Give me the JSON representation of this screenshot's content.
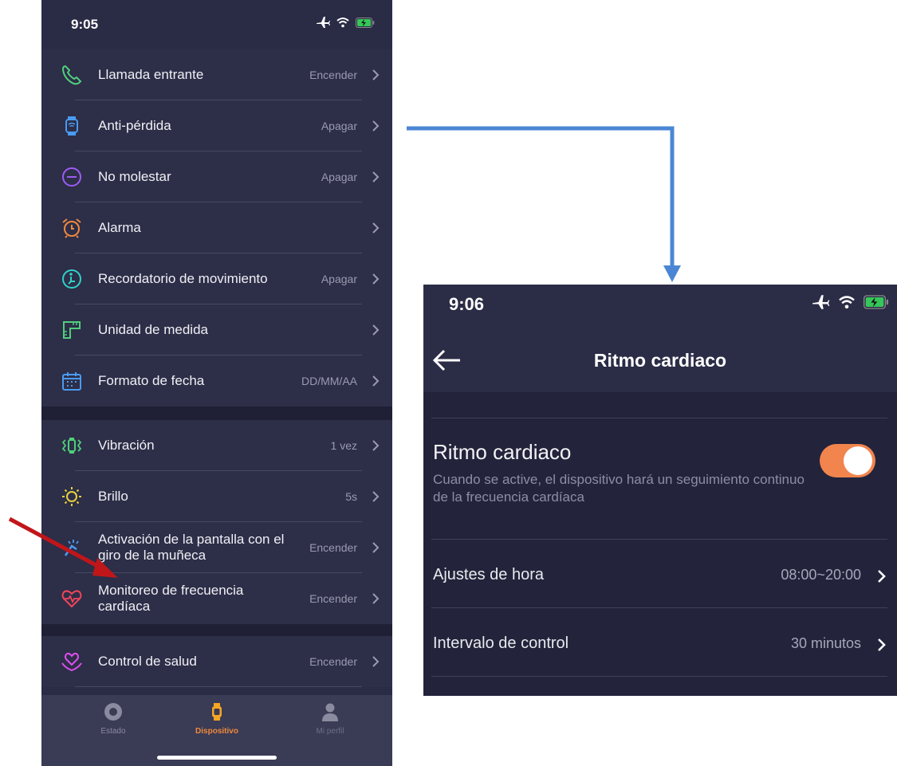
{
  "left_screen": {
    "status_time": "9:05",
    "settings_group_1": [
      {
        "label": "Llamada entrante",
        "value": "Encender",
        "icon": "phone-icon"
      },
      {
        "label": "Anti-pérdida",
        "value": "Apagar",
        "icon": "watch-signal-icon"
      },
      {
        "label": "No molestar",
        "value": "Apagar",
        "icon": "do-not-disturb-icon"
      },
      {
        "label": "Alarma",
        "value": "",
        "icon": "alarm-clock-icon"
      },
      {
        "label": "Recordatorio de movimiento",
        "value": "Apagar",
        "icon": "movement-reminder-icon"
      },
      {
        "label": "Unidad de medida",
        "value": "",
        "icon": "ruler-icon"
      },
      {
        "label": "Formato de fecha",
        "value": "DD/MM/AA",
        "icon": "calendar-icon"
      }
    ],
    "settings_group_2": [
      {
        "label": "Vibración",
        "value": "1 vez",
        "icon": "vibration-icon"
      },
      {
        "label": "Brillo",
        "value": "5s",
        "icon": "brightness-icon"
      },
      {
        "label": "Activación de la pantalla con el giro de la muñeca",
        "value": "Encender",
        "icon": "wrist-raise-icon"
      },
      {
        "label": "Monitoreo de frecuencia cardíaca",
        "value": "Encender",
        "icon": "heart-rate-icon"
      }
    ],
    "settings_group_3": [
      {
        "label": "Control de salud",
        "value": "Encender",
        "icon": "health-heart-hands-icon"
      }
    ],
    "tabs": [
      {
        "label": "Estado",
        "icon": "status-icon",
        "active": false
      },
      {
        "label": "Dispositivo",
        "icon": "watch-icon",
        "active": true
      },
      {
        "label": "Mi perfil",
        "icon": "profile-icon",
        "active": false
      }
    ]
  },
  "right_screen": {
    "status_time": "9:06",
    "nav_title": "Ritmo cardiaco",
    "heart_rate": {
      "title": "Ritmo cardiaco",
      "description": "Cuando se active, el dispositivo hará un seguimiento continuo de la frecuencia cardíaca",
      "enabled": true
    },
    "rows": [
      {
        "label": "Ajustes de hora",
        "value": "08:00~20:00"
      },
      {
        "label": "Intervalo de control",
        "value": "30 minutos"
      }
    ]
  },
  "colors": {
    "background": "#2a2b45",
    "accent_orange": "#f2844d",
    "annotation_arrow": "#c0161a",
    "connector_arrow": "#4a86d4",
    "active_tab": "#f08a3c"
  }
}
